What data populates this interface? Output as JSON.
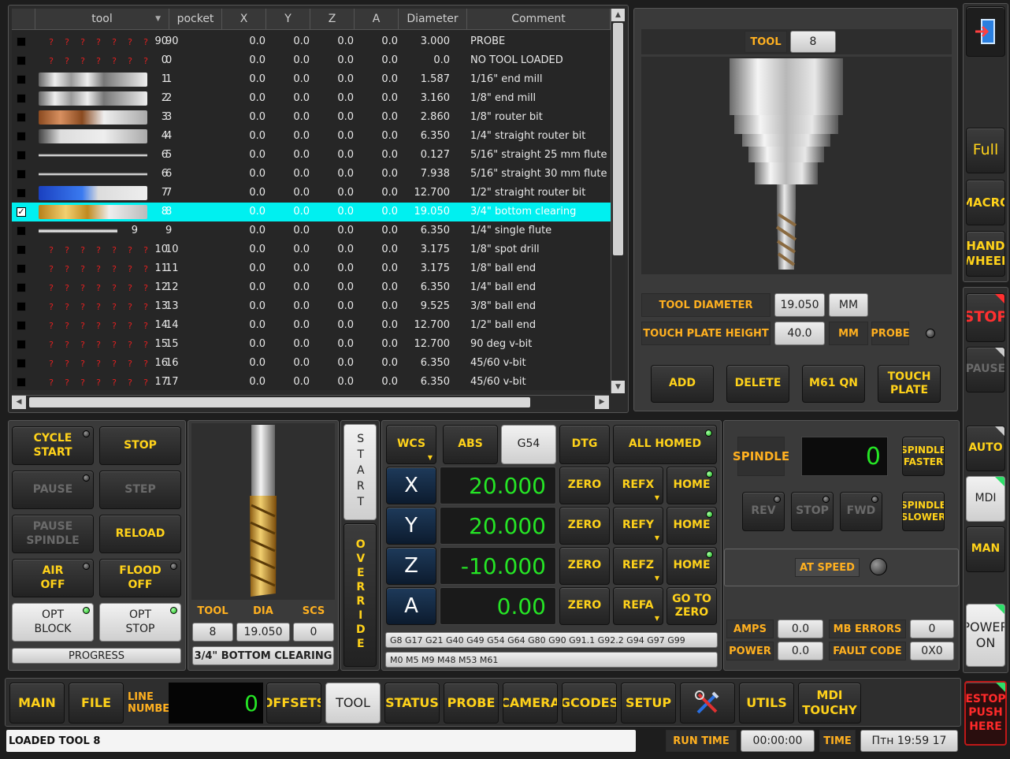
{
  "tool_table": {
    "headers": [
      "tool",
      "pocket",
      "X",
      "Y",
      "Z",
      "A",
      "Diameter",
      "Comment"
    ],
    "rows": [
      {
        "checked": false,
        "img": "none",
        "tool": "90",
        "pocket": "90",
        "x": "0.0",
        "y": "0.0",
        "z": "0.0",
        "a": "0.0",
        "dia": "3.000",
        "comment": "PROBE"
      },
      {
        "checked": false,
        "img": "none",
        "tool": "0",
        "pocket": "0",
        "x": "0.0",
        "y": "0.0",
        "z": "0.0",
        "a": "0.0",
        "dia": "0.0",
        "comment": "NO TOOL LOADED"
      },
      {
        "checked": false,
        "img": "mill",
        "tool": "1",
        "pocket": "1",
        "x": "0.0",
        "y": "0.0",
        "z": "0.0",
        "a": "0.0",
        "dia": "1.587",
        "comment": "1/16\" end mill"
      },
      {
        "checked": false,
        "img": "mill",
        "tool": "2",
        "pocket": "2",
        "x": "0.0",
        "y": "0.0",
        "z": "0.0",
        "a": "0.0",
        "dia": "3.160",
        "comment": "1/8\" end mill"
      },
      {
        "checked": false,
        "img": "bronze",
        "tool": "3",
        "pocket": "3",
        "x": "0.0",
        "y": "0.0",
        "z": "0.0",
        "a": "0.0",
        "dia": "2.860",
        "comment": "1/8\" router bit"
      },
      {
        "checked": false,
        "img": "point",
        "tool": "4",
        "pocket": "4",
        "x": "0.0",
        "y": "0.0",
        "z": "0.0",
        "a": "0.0",
        "dia": "6.350",
        "comment": "1/4\" straight router bit"
      },
      {
        "checked": false,
        "img": "thin",
        "tool": "6",
        "pocket": "5",
        "x": "0.0",
        "y": "0.0",
        "z": "0.0",
        "a": "0.0",
        "dia": "0.127",
        "comment": "5/16\" straight 25 mm flute"
      },
      {
        "checked": false,
        "img": "thin",
        "tool": "6",
        "pocket": "6",
        "x": "0.0",
        "y": "0.0",
        "z": "0.0",
        "a": "0.0",
        "dia": "7.938",
        "comment": "5/16\" straight 30 mm flute"
      },
      {
        "checked": false,
        "img": "blue",
        "tool": "7",
        "pocket": "7",
        "x": "0.0",
        "y": "0.0",
        "z": "0.0",
        "a": "0.0",
        "dia": "12.700",
        "comment": "1/2\" straight router bit"
      },
      {
        "checked": true,
        "img": "gold",
        "tool": "8",
        "pocket": "8",
        "x": "0.0",
        "y": "0.0",
        "z": "0.0",
        "a": "0.0",
        "dia": "19.050",
        "comment": "3/4\" bottom clearing"
      },
      {
        "checked": false,
        "img": "single",
        "tool": "9",
        "pocket": "9",
        "x": "0.0",
        "y": "0.0",
        "z": "0.0",
        "a": "0.0",
        "dia": "6.350",
        "comment": "1/4\" single flute"
      },
      {
        "checked": false,
        "img": "none",
        "tool": "10",
        "pocket": "10",
        "x": "0.0",
        "y": "0.0",
        "z": "0.0",
        "a": "0.0",
        "dia": "3.175",
        "comment": "1/8\" spot drill"
      },
      {
        "checked": false,
        "img": "none",
        "tool": "11",
        "pocket": "11",
        "x": "0.0",
        "y": "0.0",
        "z": "0.0",
        "a": "0.0",
        "dia": "3.175",
        "comment": "1/8\" ball end"
      },
      {
        "checked": false,
        "img": "none",
        "tool": "12",
        "pocket": "12",
        "x": "0.0",
        "y": "0.0",
        "z": "0.0",
        "a": "0.0",
        "dia": "6.350",
        "comment": "1/4\" ball end"
      },
      {
        "checked": false,
        "img": "none",
        "tool": "13",
        "pocket": "13",
        "x": "0.0",
        "y": "0.0",
        "z": "0.0",
        "a": "0.0",
        "dia": "9.525",
        "comment": "3/8\" ball end"
      },
      {
        "checked": false,
        "img": "none",
        "tool": "14",
        "pocket": "14",
        "x": "0.0",
        "y": "0.0",
        "z": "0.0",
        "a": "0.0",
        "dia": "12.700",
        "comment": "1/2\" ball end"
      },
      {
        "checked": false,
        "img": "none",
        "tool": "15",
        "pocket": "15",
        "x": "0.0",
        "y": "0.0",
        "z": "0.0",
        "a": "0.0",
        "dia": "12.700",
        "comment": "90 deg v-bit"
      },
      {
        "checked": false,
        "img": "none",
        "tool": "16",
        "pocket": "16",
        "x": "0.0",
        "y": "0.0",
        "z": "0.0",
        "a": "0.0",
        "dia": "6.350",
        "comment": "45/60 v-bit"
      },
      {
        "checked": false,
        "img": "none",
        "tool": "17",
        "pocket": "17",
        "x": "0.0",
        "y": "0.0",
        "z": "0.0",
        "a": "0.0",
        "dia": "6.350",
        "comment": "45/60 v-bit"
      }
    ],
    "qmark": "?"
  },
  "tool_panel": {
    "tool_label": "TOOL",
    "tool_value": "8",
    "tool_diameter_label": "TOOL DIAMETER",
    "tool_diameter_value": "19.050",
    "tool_diameter_unit": "MM",
    "touch_plate_label": "TOUCH PLATE HEIGHT",
    "touch_plate_value": "40.0",
    "touch_plate_unit": "MM",
    "probe_label": "PROBE",
    "buttons": {
      "add": "ADD",
      "delete": "DELETE",
      "m61": "M61 QN",
      "touch_plate": "TOUCH\nPLATE"
    }
  },
  "right_bar": {
    "full": "Full",
    "macro": "MACRO",
    "hand_wheel": "HAND\nWHEEL",
    "stop": "STOP",
    "pause": "PAUSE",
    "auto": "AUTO",
    "mdi": "MDI",
    "man": "MAN",
    "power_on": "POWER\nON",
    "estop": "ESTOP\nPUSH\nHERE"
  },
  "cycle_panel": {
    "cycle_start": "CYCLE\nSTART",
    "stop": "STOP",
    "pause": "PAUSE",
    "step": "STEP",
    "pause_spindle": "PAUSE\nSPINDLE",
    "reload": "RELOAD",
    "air_off": "AIR\nOFF",
    "flood_off": "FLOOD\nOFF",
    "opt_block": "OPT\nBLOCK",
    "opt_stop": "OPT\nSTOP",
    "progress": "PROGRESS"
  },
  "current_tool": {
    "tool_label": "TOOL",
    "dia_label": "DIA",
    "scs_label": "SCS",
    "tool": "8",
    "dia": "19.050",
    "scs": "0",
    "description": "3/4\" BOTTOM CLEARING"
  },
  "vertical_buttons": {
    "start": "START",
    "override": "OVERRIDE"
  },
  "dro": {
    "wcs": "WCS",
    "abs": "ABS",
    "g54": "G54",
    "dtg": "DTG",
    "all_homed": "ALL HOMED",
    "axes": [
      {
        "axis": "X",
        "value": "20.000",
        "zero": "ZERO",
        "ref": "REFX",
        "home": "HOME"
      },
      {
        "axis": "Y",
        "value": "20.000",
        "zero": "ZERO",
        "ref": "REFY",
        "home": "HOME"
      },
      {
        "axis": "Z",
        "value": "-10.000",
        "zero": "ZERO",
        "ref": "REFZ",
        "home": "HOME"
      },
      {
        "axis": "A",
        "value": "0.00",
        "zero": "ZERO",
        "ref": "REFA",
        "home": "GO TO\nZERO"
      }
    ],
    "gcodes": "G8 G17 G21 G40 G49 G54 G64 G80 G90 G91.1 G92.2 G94 G97 G99",
    "mcodes": "M0 M5 M9 M48 M53 M61"
  },
  "spindle": {
    "label": "SPINDLE",
    "rpm": "0",
    "faster": "SPINDLE\nFASTER",
    "slower": "SPINDLE\nSLOWER",
    "rev": "REV",
    "stop": "STOP",
    "fwd": "FWD",
    "at_speed": "AT SPEED",
    "amps_label": "AMPS",
    "amps": "0.0",
    "power_label": "POWER",
    "power": "0.0",
    "mb_errors_label": "MB ERRORS",
    "mb_errors": "0",
    "fault_code_label": "FAULT CODE",
    "fault_code": "0X0"
  },
  "bottom_tabs": {
    "main": "MAIN",
    "file": "FILE",
    "line_number_label": "LINE\nNUMBER",
    "line_number": "0",
    "offsets": "OFFSETS",
    "tool": "TOOL",
    "status": "STATUS",
    "probe": "PROBE",
    "camera": "CAMERA",
    "gcodes": "GCODES",
    "setup": "SETUP",
    "utils": "UTILS",
    "mdi_touchy": "MDI\nTOUCHY"
  },
  "status_bar": {
    "message": "LOADED TOOL 8",
    "run_time_label": "RUN TIME",
    "run_time": "00:00:00",
    "time_label": "TIME",
    "time": "Птн 19:59 17"
  }
}
